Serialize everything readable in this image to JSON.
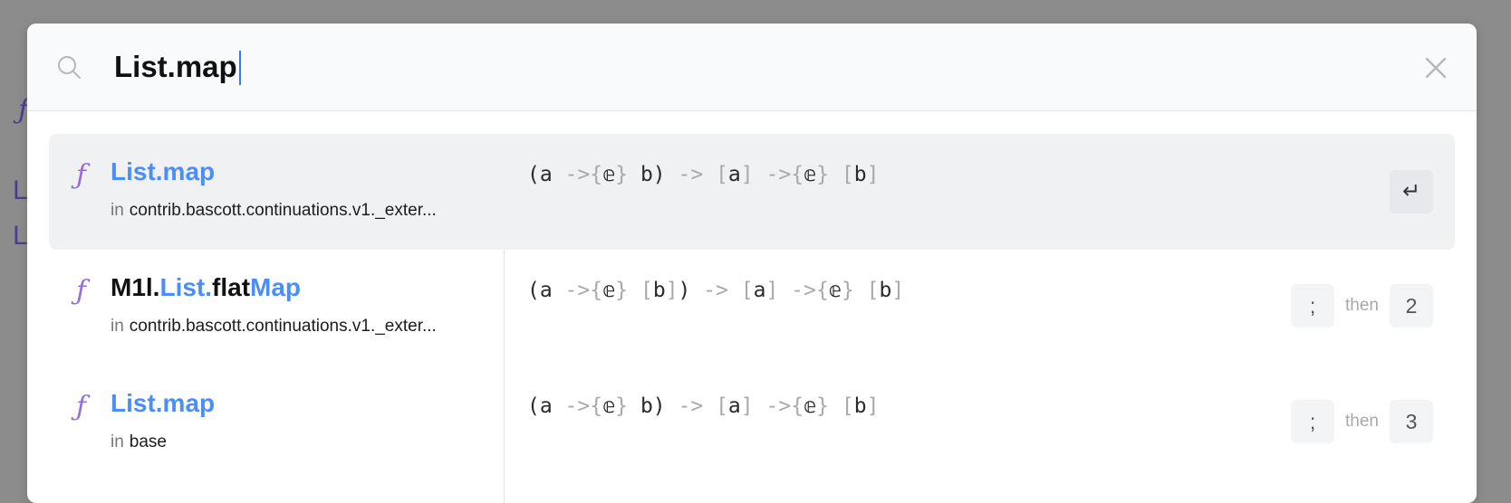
{
  "background": {
    "glyph_f": "ƒ",
    "glyph_l1": "L",
    "glyph_l2": "L"
  },
  "search": {
    "value": "List.map",
    "placeholder": ""
  },
  "close_icon": "close-icon",
  "results": [
    {
      "icon": "ƒ",
      "name_parts": [
        {
          "t": "List.map",
          "hl": true
        }
      ],
      "in_label": "in",
      "namespace": "contrib.bascott.continuations.v1._exter...",
      "signature": [
        {
          "t": "(a ",
          "d": false
        },
        {
          "t": "->{",
          "d": true
        },
        {
          "t": "𝕖",
          "d": false
        },
        {
          "t": "}",
          "d": true
        },
        {
          "t": " b) ",
          "d": false
        },
        {
          "t": "->",
          "d": true
        },
        {
          "t": " ",
          "d": false
        },
        {
          "t": "[",
          "d": true
        },
        {
          "t": "a",
          "d": false
        },
        {
          "t": "]",
          "d": true
        },
        {
          "t": " ",
          "d": false
        },
        {
          "t": "->{",
          "d": true
        },
        {
          "t": "𝕖",
          "d": false
        },
        {
          "t": "}",
          "d": true
        },
        {
          "t": " ",
          "d": false
        },
        {
          "t": "[",
          "d": true
        },
        {
          "t": "b",
          "d": false
        },
        {
          "t": "]",
          "d": true
        }
      ],
      "selected": true,
      "enter_key": "↵"
    },
    {
      "icon": "ƒ",
      "name_parts": [
        {
          "t": "M1l.",
          "hl": false
        },
        {
          "t": "List.",
          "hl": true
        },
        {
          "t": "flat",
          "hl": false
        },
        {
          "t": "Map",
          "hl": true
        }
      ],
      "in_label": "in",
      "namespace": "contrib.bascott.continuations.v1._exter...",
      "signature": [
        {
          "t": "(a ",
          "d": false
        },
        {
          "t": "->{",
          "d": true
        },
        {
          "t": "𝕖",
          "d": false
        },
        {
          "t": "}",
          "d": true
        },
        {
          "t": " ",
          "d": false
        },
        {
          "t": "[",
          "d": true
        },
        {
          "t": "b",
          "d": false
        },
        {
          "t": "]",
          "d": true
        },
        {
          "t": ") ",
          "d": false
        },
        {
          "t": "->",
          "d": true
        },
        {
          "t": " ",
          "d": false
        },
        {
          "t": "[",
          "d": true
        },
        {
          "t": "a",
          "d": false
        },
        {
          "t": "]",
          "d": true
        },
        {
          "t": " ",
          "d": false
        },
        {
          "t": "->{",
          "d": true
        },
        {
          "t": "𝕖",
          "d": false
        },
        {
          "t": "}",
          "d": true
        },
        {
          "t": " ",
          "d": false
        },
        {
          "t": "[",
          "d": true
        },
        {
          "t": "b",
          "d": false
        },
        {
          "t": "]",
          "d": true
        }
      ],
      "selected": false,
      "shortcut_key": ";",
      "then_label": "then",
      "shortcut_num": "2"
    },
    {
      "icon": "ƒ",
      "name_parts": [
        {
          "t": "List.map",
          "hl": true
        }
      ],
      "in_label": "in",
      "namespace": "base",
      "signature": [
        {
          "t": "(a ",
          "d": false
        },
        {
          "t": "->{",
          "d": true
        },
        {
          "t": "𝕖",
          "d": false
        },
        {
          "t": "}",
          "d": true
        },
        {
          "t": " b) ",
          "d": false
        },
        {
          "t": "->",
          "d": true
        },
        {
          "t": " ",
          "d": false
        },
        {
          "t": "[",
          "d": true
        },
        {
          "t": "a",
          "d": false
        },
        {
          "t": "]",
          "d": true
        },
        {
          "t": " ",
          "d": false
        },
        {
          "t": "->{",
          "d": true
        },
        {
          "t": "𝕖",
          "d": false
        },
        {
          "t": "}",
          "d": true
        },
        {
          "t": " ",
          "d": false
        },
        {
          "t": "[",
          "d": true
        },
        {
          "t": "b",
          "d": false
        },
        {
          "t": "]",
          "d": true
        }
      ],
      "selected": false,
      "shortcut_key": ";",
      "then_label": "then",
      "shortcut_num": "3"
    }
  ]
}
